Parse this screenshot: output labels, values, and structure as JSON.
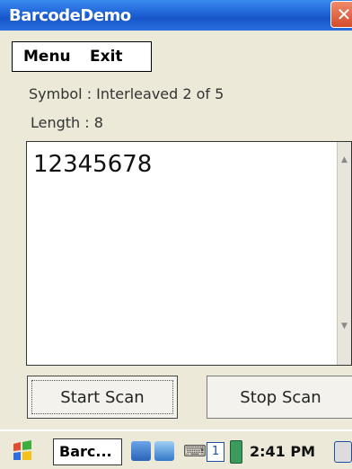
{
  "window": {
    "title": "BarcodeDemo",
    "close_glyph": "✕"
  },
  "menu": {
    "items": [
      {
        "label": "Menu"
      },
      {
        "label": "Exit"
      }
    ]
  },
  "info": {
    "symbol_text": "Symbol : Interleaved 2 of 5",
    "length_text": "Length : 8"
  },
  "result": {
    "value": "12345678"
  },
  "buttons": {
    "start_label": "Start Scan",
    "stop_label": "Stop Scan"
  },
  "taskbar": {
    "start_icon": "windows-flag-icon",
    "task_label": "Barc...",
    "clock": "2:41 PM",
    "input_indicator": "1",
    "keyboard_glyph": "⌨",
    "flag_glyph": "✱"
  },
  "colors": {
    "titlebar": "#1f63d6",
    "close": "#d44b2a",
    "background": "#ece9d8"
  }
}
